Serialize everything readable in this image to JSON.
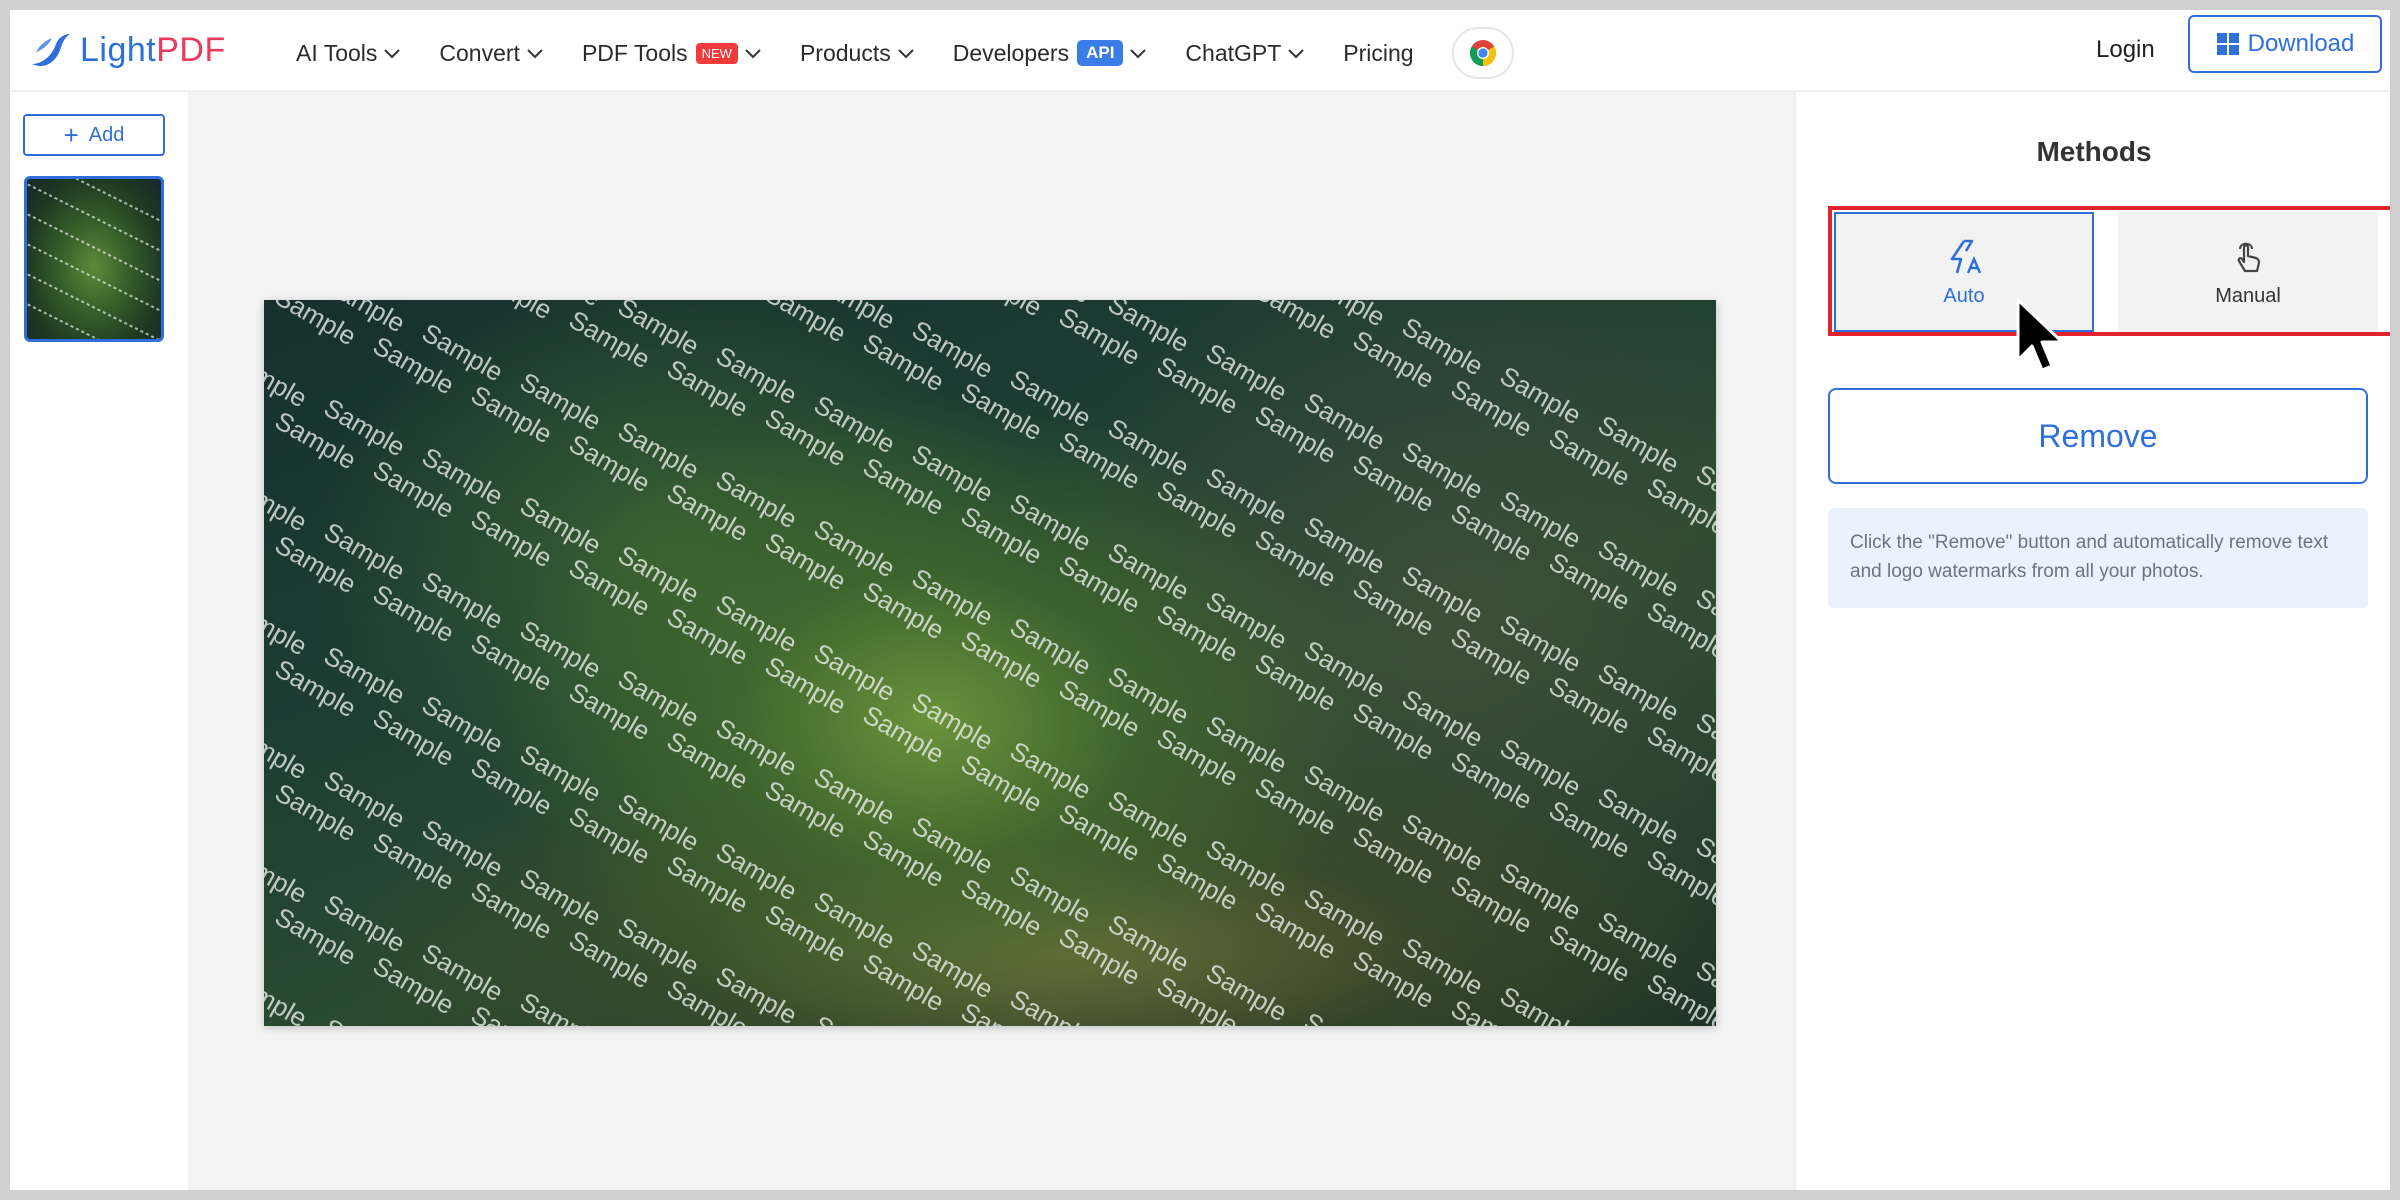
{
  "brand": {
    "light": "Light",
    "pdf": "PDF",
    "light_color": "#2e6fd9",
    "pdf_color": "#ec3a5f"
  },
  "nav": {
    "ai_tools": "AI Tools",
    "convert": "Convert",
    "pdf_tools": "PDF Tools",
    "pdf_tools_badge": "NEW",
    "products": "Products",
    "developers": "Developers",
    "developers_badge": "API",
    "chatgpt": "ChatGPT",
    "pricing": "Pricing"
  },
  "header_actions": {
    "login": "Login",
    "download": "Download"
  },
  "sidebar": {
    "add_label": "Add"
  },
  "canvas": {
    "watermark_text": "Sample"
  },
  "panel": {
    "title": "Methods",
    "methods": [
      {
        "label": "Auto",
        "icon": "auto-flash-icon",
        "selected": true
      },
      {
        "label": "Manual",
        "icon": "hand-pointer-icon",
        "selected": false
      }
    ],
    "remove_label": "Remove",
    "hint": "Click the \"Remove\" button and automatically remove text and logo watermarks from all your photos."
  },
  "colors": {
    "accent": "#2f6fdc",
    "highlight": "#e3222f",
    "new_badge": "#f03b3b",
    "api_badge": "#3a7ce8"
  }
}
